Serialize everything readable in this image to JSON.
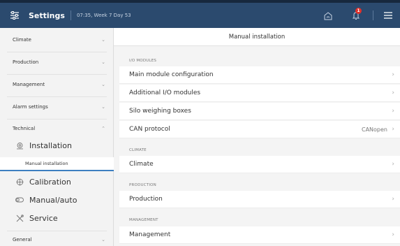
{
  "header": {
    "title": "Settings",
    "datetime": "07:35, Week 7 Day 53",
    "notification_count": "1",
    "colors": {
      "bar": "#2b4a6e",
      "badge": "#e0312b"
    }
  },
  "sidebar": {
    "categories": {
      "climate": "Climate",
      "production": "Production",
      "management": "Management",
      "alarm_settings": "Alarm settings",
      "technical": "Technical",
      "general": "General"
    },
    "items": {
      "installation": "Installation",
      "manual_installation": "Manual installation",
      "calibration": "Calibration",
      "manual_auto": "Manual/auto",
      "service": "Service"
    }
  },
  "main": {
    "title": "Manual installation",
    "sections": {
      "io_modules": "I/O MODULES",
      "climate": "CLIMATE",
      "production": "PRODUCTION",
      "management": "MANAGEMENT"
    },
    "rows": {
      "main_module": "Main module configuration",
      "additional_io": "Additional I/O modules",
      "silo": "Silo weighing boxes",
      "can": "CAN protocol",
      "can_value": "CANopen",
      "climate": "Climate",
      "production": "Production",
      "management": "Management"
    }
  }
}
